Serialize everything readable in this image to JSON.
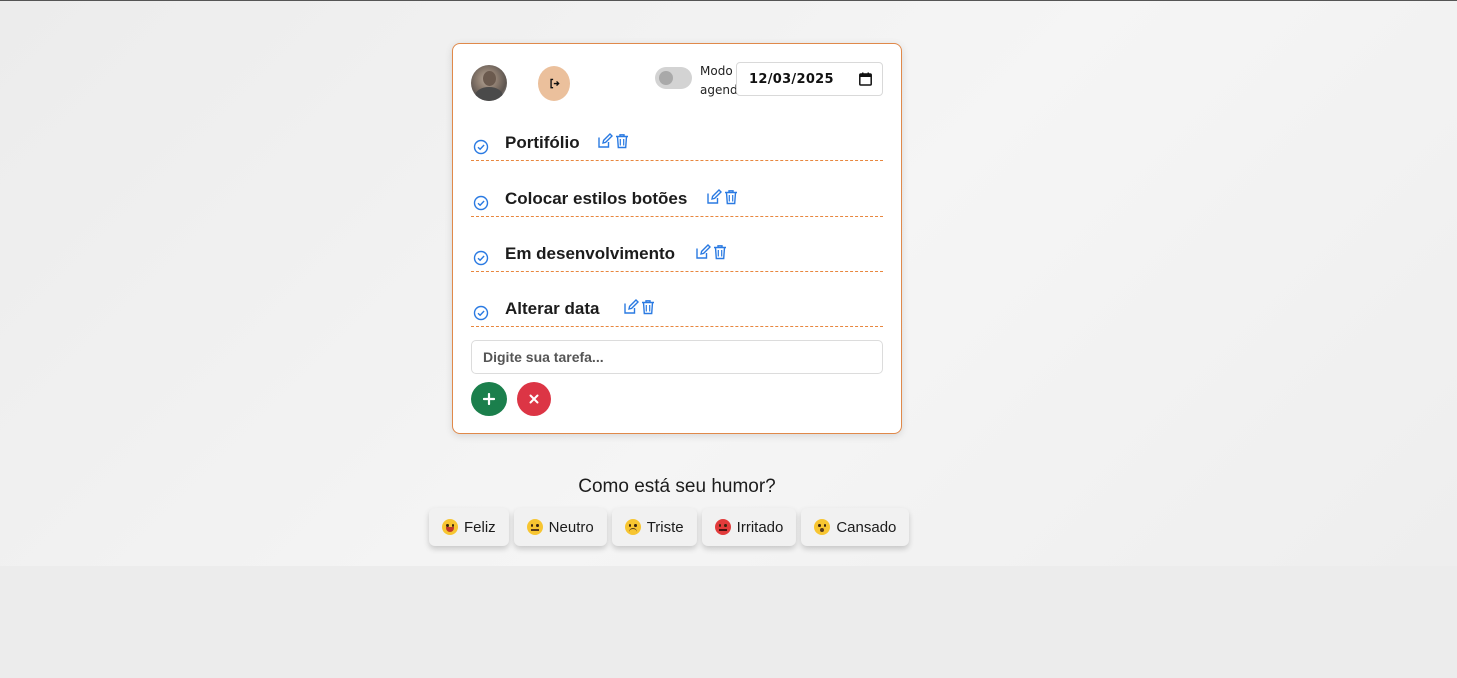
{
  "header": {
    "toggle_label": "Modo agenda",
    "date_value": "12/03/2025"
  },
  "tasks": [
    {
      "title": "Portifólio"
    },
    {
      "title": "Colocar estilos botões"
    },
    {
      "title": "Em desenvolvimento"
    },
    {
      "title": "Alterar data"
    }
  ],
  "input": {
    "placeholder": "Digite sua tarefa..."
  },
  "mood": {
    "question": "Como está seu humor?",
    "options": [
      {
        "label": "Feliz",
        "icon": "happy-emoji"
      },
      {
        "label": "Neutro",
        "icon": "neutral-emoji"
      },
      {
        "label": "Triste",
        "icon": "sad-emoji"
      },
      {
        "label": "Irritado",
        "icon": "angry-emoji"
      },
      {
        "label": "Cansado",
        "icon": "tired-emoji"
      }
    ]
  },
  "colors": {
    "accent_orange": "#e0894a",
    "icon_blue": "#2a7ae2",
    "add_green": "#1b7f4c",
    "cancel_red": "#dc3545",
    "logout_bg": "#ebc09c"
  }
}
